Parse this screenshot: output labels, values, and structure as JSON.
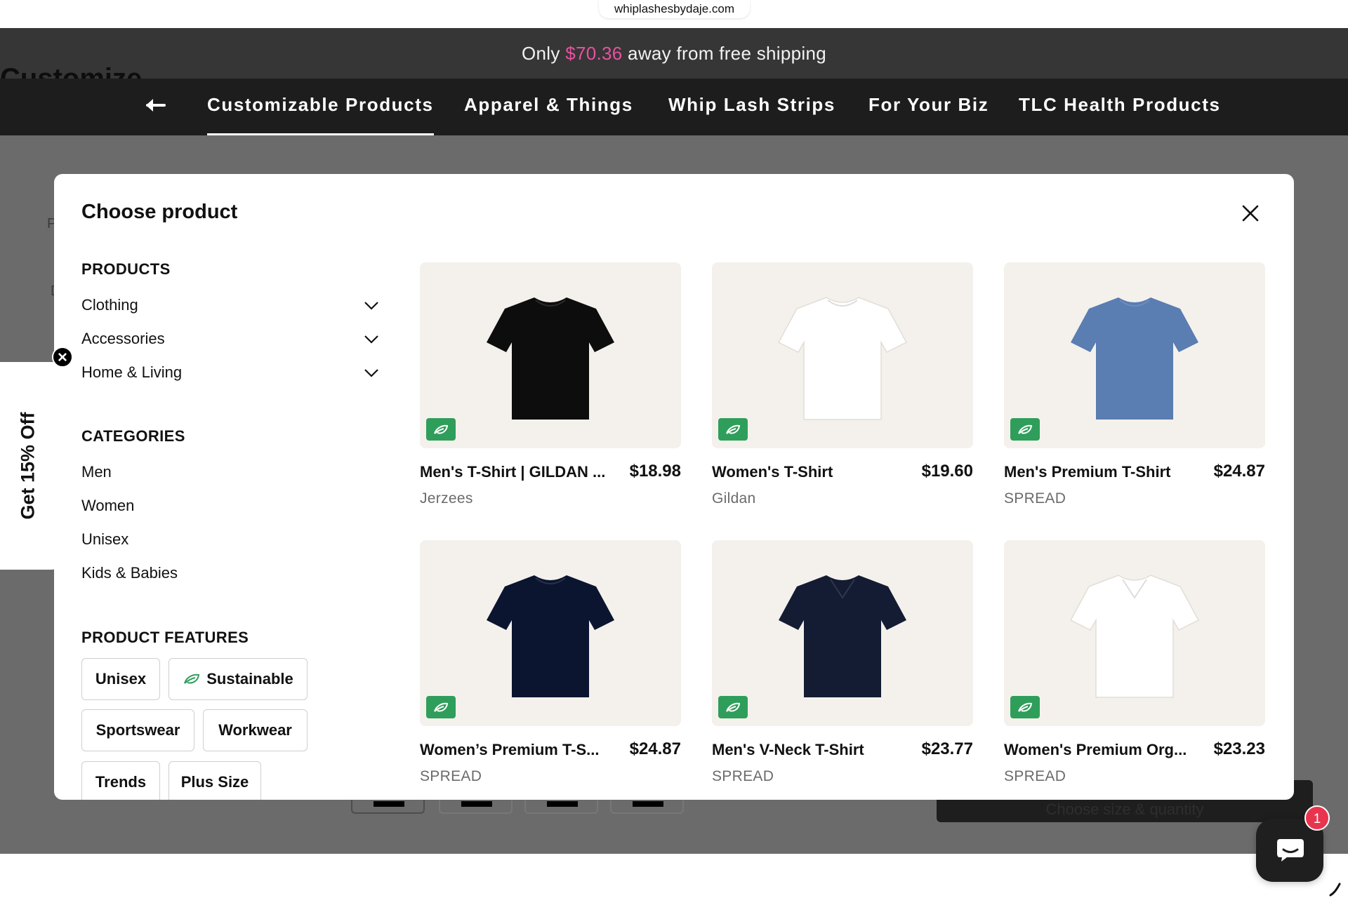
{
  "browser": {
    "url": "whiplashesbydaje.com"
  },
  "announcement": {
    "prefix": "Only ",
    "amount": "$70.36",
    "suffix": " away from free shipping"
  },
  "background": {
    "heading_fragment": "Customize",
    "letter_p": "P",
    "letter_d": "D",
    "cta_label": "Choose size & quantity"
  },
  "nav": {
    "tabs": [
      {
        "label": "Customizable Products",
        "active": true
      },
      {
        "label": "Apparel & Things",
        "active": false
      },
      {
        "label": "Whip Lash Strips",
        "active": false
      },
      {
        "label": "For Your Biz",
        "active": false
      },
      {
        "label": "TLC Health Products",
        "active": false
      }
    ]
  },
  "modal": {
    "title": "Choose product",
    "products_heading": "PRODUCTS",
    "product_groups": [
      "Clothing",
      "Accessories",
      "Home & Living"
    ],
    "categories_heading": "CATEGORIES",
    "categories": [
      "Men",
      "Women",
      "Unisex",
      "Kids & Babies"
    ],
    "features_heading": "PRODUCT FEATURES",
    "features": [
      "Unisex",
      "Sustainable",
      "Sportswear",
      "Workwear",
      "Trends",
      "Plus Size"
    ],
    "cards": [
      {
        "name": "Men's T-Shirt | GILDAN ...",
        "price": "$18.98",
        "brand": "Jerzees",
        "color": "#0d0d0d"
      },
      {
        "name": "Women's T-Shirt",
        "price": "$19.60",
        "brand": "Gildan",
        "color": "#ffffff"
      },
      {
        "name": "Men's Premium T-Shirt",
        "price": "$24.87",
        "brand": "SPREAD",
        "color": "#5a7db2"
      },
      {
        "name": "Women’s Premium T-S...",
        "price": "$24.87",
        "brand": "SPREAD",
        "color": "#0b1530"
      },
      {
        "name": "Men's V-Neck T-Shirt",
        "price": "$23.77",
        "brand": "SPREAD",
        "color": "#141c33"
      },
      {
        "name": "Women's Premium Org...",
        "price": "$23.23",
        "brand": "SPREAD",
        "color": "#ffffff"
      }
    ]
  },
  "discount_tab": {
    "label": "Get 15% Off"
  },
  "chat": {
    "badge_count": "1"
  },
  "colors": {
    "accent_pink": "#e8519f",
    "eco_green": "#2f9e5b",
    "nav_bg": "#1d1d1d",
    "announce_bg": "#363636"
  }
}
